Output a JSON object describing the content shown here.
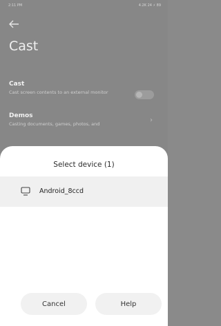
{
  "status_bar": {
    "time": "2:11 PM",
    "indicators": "4.2K 24 ⚡ 89"
  },
  "page": {
    "title": "Cast"
  },
  "settings": [
    {
      "title": "Cast",
      "description": "Cast screen contents to an external monitor"
    },
    {
      "title": "Demos",
      "description": "Casting documents, games, photos, and"
    }
  ],
  "sheet": {
    "title": "Select device (1)",
    "devices": [
      {
        "name": "Android_8ccd",
        "icon": "monitor-icon"
      }
    ],
    "cancel_label": "Cancel",
    "help_label": "Help"
  }
}
